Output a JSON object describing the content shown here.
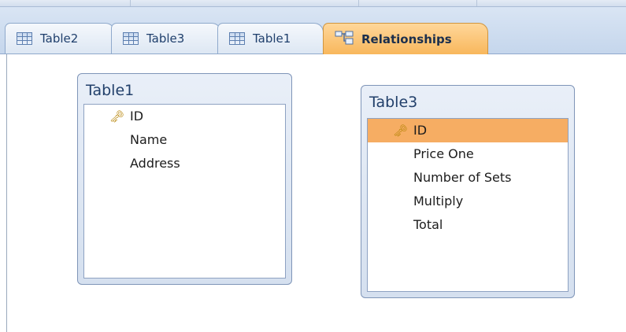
{
  "top_strip": {
    "visible": "partially cut off header row"
  },
  "tabs": [
    {
      "label": "Table2",
      "icon": "table-grid-icon",
      "active": false
    },
    {
      "label": "Table3",
      "icon": "table-grid-icon",
      "active": false
    },
    {
      "label": "Table1",
      "icon": "table-grid-icon",
      "active": false
    },
    {
      "label": "Relationships",
      "icon": "relationships-icon",
      "active": true
    }
  ],
  "relationships": {
    "tables": [
      {
        "title": "Table1",
        "fields": [
          {
            "name": "ID",
            "primary_key": true,
            "selected": false
          },
          {
            "name": "Name",
            "primary_key": false,
            "selected": false
          },
          {
            "name": "Address",
            "primary_key": false,
            "selected": false
          }
        ]
      },
      {
        "title": "Table3",
        "fields": [
          {
            "name": "ID",
            "primary_key": true,
            "selected": true
          },
          {
            "name": "Price One",
            "primary_key": false,
            "selected": false
          },
          {
            "name": "Number of Sets",
            "primary_key": false,
            "selected": false
          },
          {
            "name": "Multiply",
            "primary_key": false,
            "selected": false
          },
          {
            "name": "Total",
            "primary_key": false,
            "selected": false
          }
        ]
      }
    ]
  },
  "colors": {
    "active_tab": "#f8b75c",
    "selected_row": "#f6ad63",
    "tab_bar": "#c5d6ec",
    "table_title": "#22406b"
  }
}
